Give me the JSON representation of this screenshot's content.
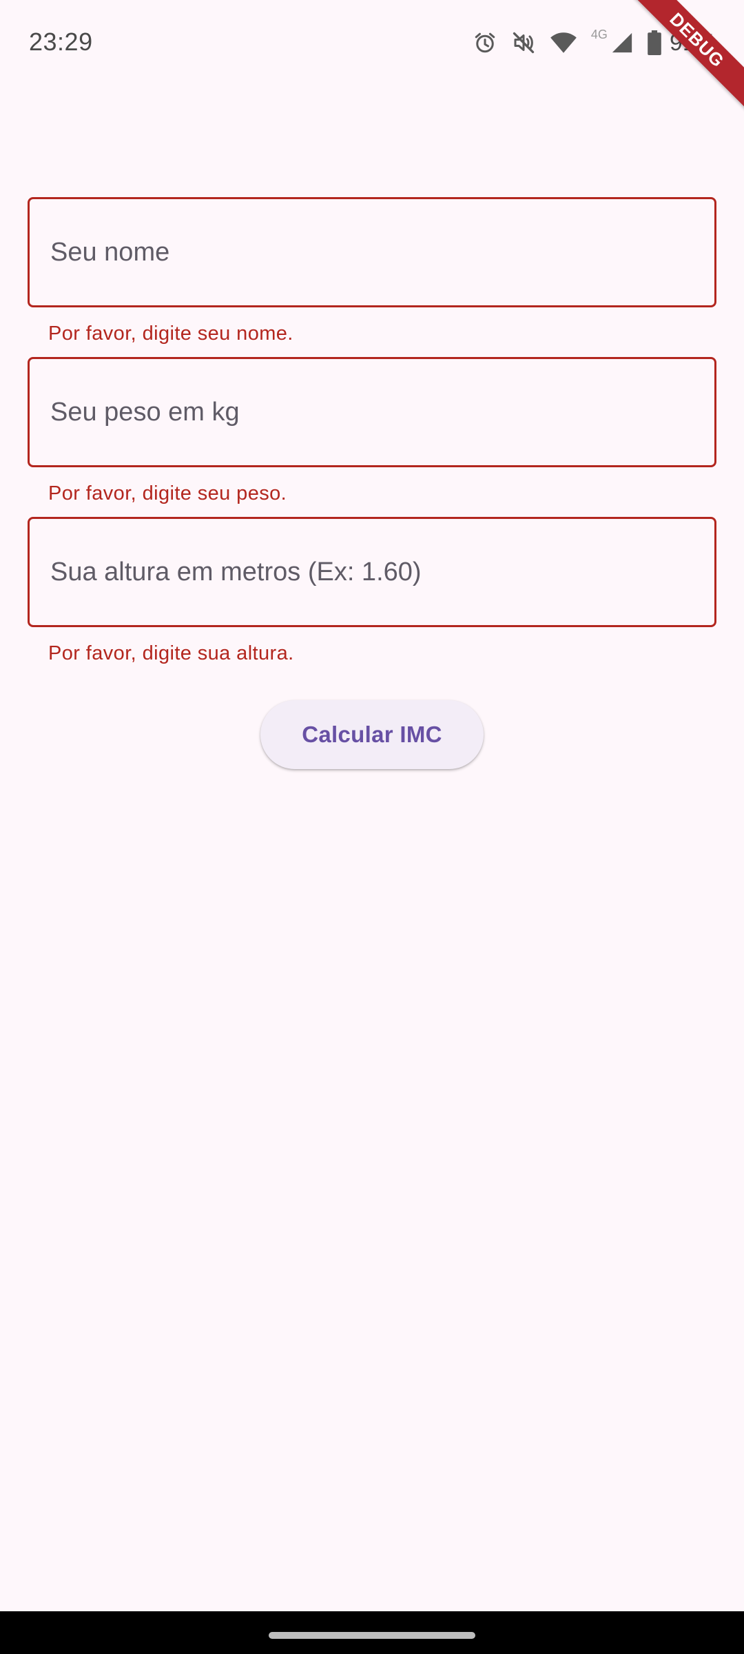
{
  "status_bar": {
    "time": "23:29",
    "network_label": "4G",
    "battery_percent": "91%",
    "icons": [
      "alarm-icon",
      "mute-icon",
      "wifi-icon",
      "signal-icon",
      "battery-icon"
    ]
  },
  "debug_banner": {
    "label": "DEBUG",
    "color": "#b3262d"
  },
  "form": {
    "fields": [
      {
        "placeholder": "Seu nome",
        "value": "",
        "error": "Por favor, digite seu nome."
      },
      {
        "placeholder": "Seu peso em kg",
        "value": "",
        "error": "Por favor, digite seu peso."
      },
      {
        "placeholder": "Sua altura em metros (Ex: 1.60)",
        "value": "",
        "error": "Por favor, digite sua altura."
      }
    ],
    "submit_label": "Calcular IMC"
  },
  "colors": {
    "background": "#fef7fb",
    "error": "#b3261e",
    "primary": "#6750a4",
    "button_surface": "#f3edf7"
  }
}
